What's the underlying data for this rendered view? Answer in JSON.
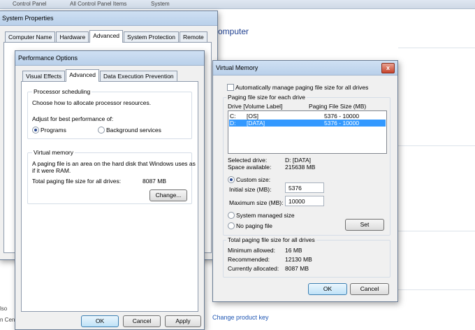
{
  "background": {
    "breadcrumb": [
      "Control Panel",
      "All Control Panel Items",
      "System"
    ],
    "heading": "omputer",
    "link": "Change product key",
    "left_fragments": [
      "lso",
      "n Cen"
    ]
  },
  "system_properties": {
    "title": "System Properties",
    "tabs": [
      "Computer Name",
      "Hardware",
      "Advanced",
      "System Protection",
      "Remote"
    ]
  },
  "performance_options": {
    "title": "Performance Options",
    "tabs": [
      "Visual Effects",
      "Advanced",
      "Data Execution Prevention"
    ],
    "processor_group_title": "Processor scheduling",
    "processor_desc": "Choose how to allocate processor resources.",
    "adjust_label": "Adjust for best performance of:",
    "radio_programs": "Programs",
    "radio_background": "Background services",
    "vm_group_title": "Virtual memory",
    "vm_desc_line1": "A paging file is an area on the hard disk that Windows uses as",
    "vm_desc_line2": "if it were RAM.",
    "total_label": "Total paging file size for all drives:",
    "total_value": "8087 MB",
    "change_button": "Change...",
    "ok_button": "OK",
    "cancel_button": "Cancel",
    "apply_button": "Apply"
  },
  "virtual_memory": {
    "title": "Virtual Memory",
    "auto_manage_label": "Automatically manage paging file size for all drives",
    "auto_manage_checked": false,
    "each_drive_title": "Paging file size for each drive",
    "col_drive": "Drive  [Volume Label]",
    "col_size": "Paging File Size (MB)",
    "drives": [
      {
        "drive": "C:",
        "label": "[OS]",
        "size": "5376 - 10000",
        "selected": false
      },
      {
        "drive": "D:",
        "label": "[DATA]",
        "size": "5376 - 10000",
        "selected": true
      }
    ],
    "selected_drive_label": "Selected drive:",
    "selected_drive_value": "D:  [DATA]",
    "space_available_label": "Space available:",
    "space_available_value": "215638 MB",
    "custom_size_label": "Custom size:",
    "initial_size_label": "Initial size (MB):",
    "initial_size_value": "5376",
    "max_size_label": "Maximum size (MB):",
    "max_size_value": "10000",
    "system_managed_label": "System managed size",
    "no_paging_label": "No paging file",
    "set_button": "Set",
    "total_group_title": "Total paging file size for all drives",
    "min_allowed_label": "Minimum allowed:",
    "min_allowed_value": "16 MB",
    "recommended_label": "Recommended:",
    "recommended_value": "12130 MB",
    "currently_allocated_label": "Currently allocated:",
    "currently_allocated_value": "8087 MB",
    "ok_button": "OK",
    "cancel_button": "Cancel",
    "close_glyph": "x"
  }
}
